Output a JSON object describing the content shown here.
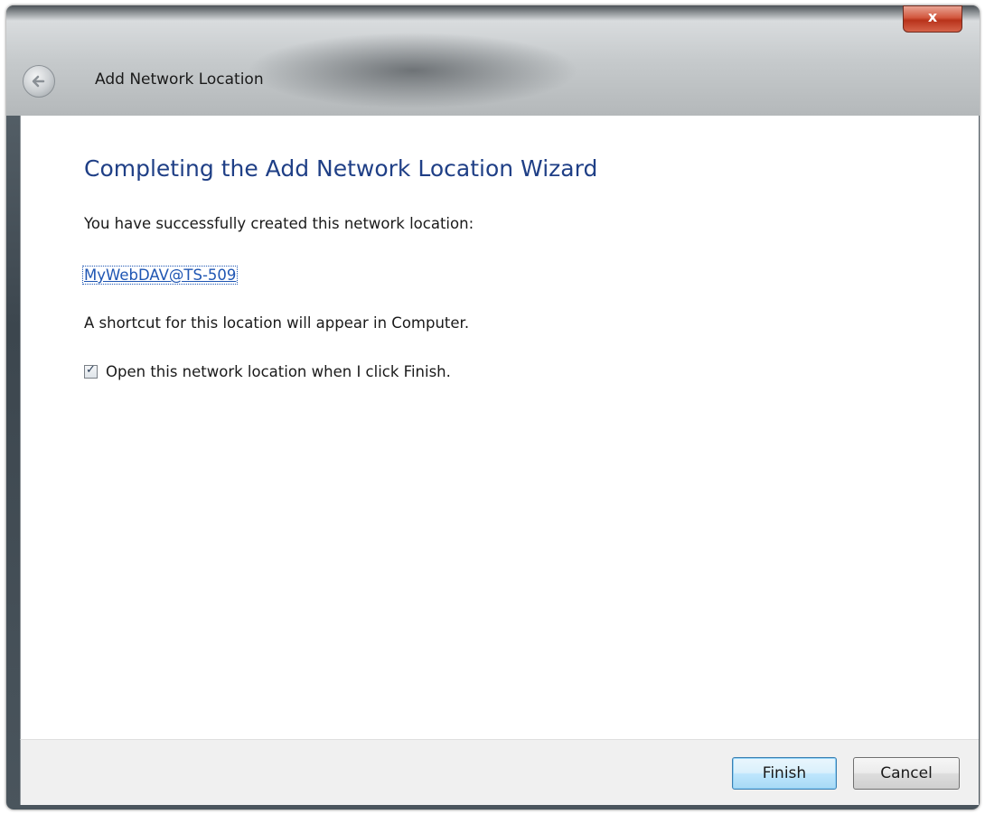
{
  "window": {
    "title": "Add Network Location",
    "close_label": "x"
  },
  "wizard": {
    "heading": "Completing the Add Network Location Wizard",
    "success_text": "You have successfully created this network location:",
    "location_name": "MyWebDAV@TS-509",
    "shortcut_text": "A shortcut for this location will appear in Computer.",
    "open_checkbox": {
      "label": "Open this network location when I click Finish.",
      "checked": true
    }
  },
  "footer": {
    "finish_label": "Finish",
    "cancel_label": "Cancel"
  },
  "colors": {
    "heading": "#1f3f86",
    "link": "#1f56b3",
    "close_button": "#c9452b",
    "default_button_border": "#3c7fb1"
  },
  "icons": {
    "back": "back-arrow-icon",
    "close": "close-icon",
    "check": "checkmark-icon"
  }
}
